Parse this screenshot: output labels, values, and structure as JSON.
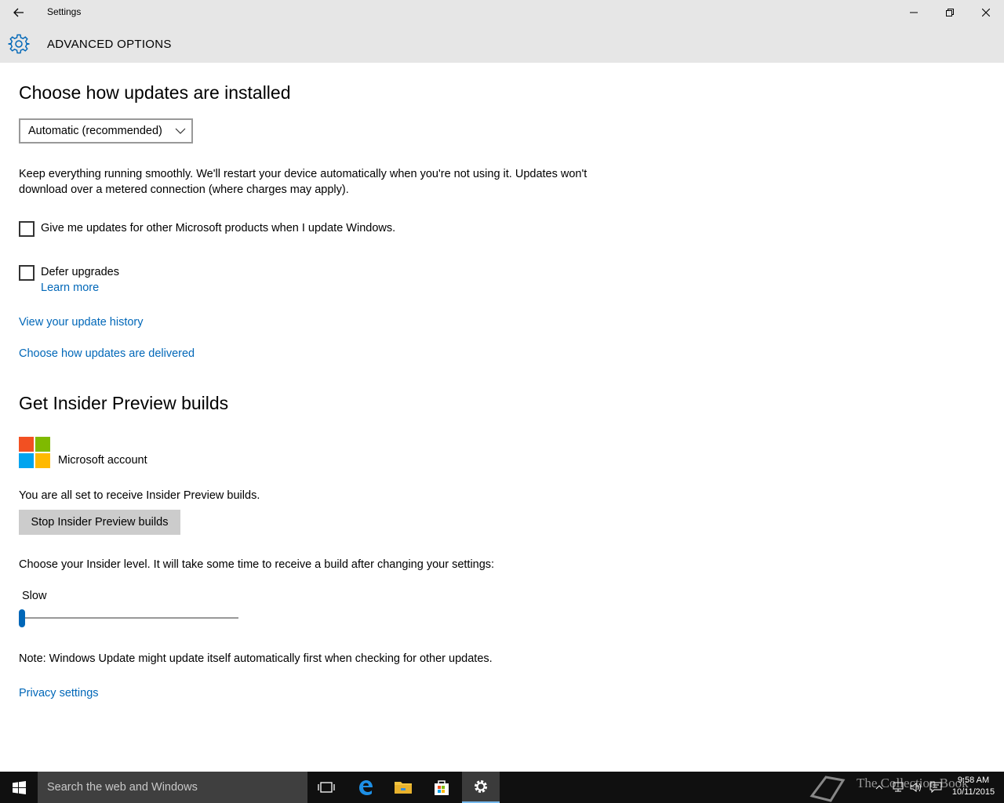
{
  "window": {
    "title": "Settings"
  },
  "header": {
    "title": "ADVANCED OPTIONS"
  },
  "install": {
    "heading": "Choose how updates are installed",
    "selected": "Automatic (recommended)",
    "description_line1": "Keep everything running smoothly. We'll restart your device automatically when you're not using it. Updates won't",
    "description_line2": "download over a metered connection (where charges may apply).",
    "checkbox_other_products": "Give me updates for other Microsoft products when I update Windows.",
    "checkbox_defer": "Defer upgrades",
    "learn_more": "Learn more",
    "link_history": "View your update history",
    "link_delivery": "Choose how updates are delivered"
  },
  "insider": {
    "heading": "Get Insider Preview builds",
    "account_label": "Microsoft account",
    "status": "You are all set to receive Insider Preview builds.",
    "stop_button": "Stop Insider Preview builds",
    "level_prompt": "Choose your Insider level. It will take some time to receive a build after changing your settings:",
    "level_value": "Slow",
    "note": "Note: Windows Update might update itself automatically first when checking for other updates.",
    "privacy_link": "Privacy settings"
  },
  "taskbar": {
    "search_placeholder": "Search the web and Windows",
    "time": "9:58 AM",
    "date": "10/11/2015",
    "watermark": "The Collection Book"
  },
  "colors": {
    "accent": "#0067b8",
    "ms_red": "#f25022",
    "ms_green": "#7fba00",
    "ms_blue": "#00a4ef",
    "ms_yellow": "#ffb900"
  }
}
